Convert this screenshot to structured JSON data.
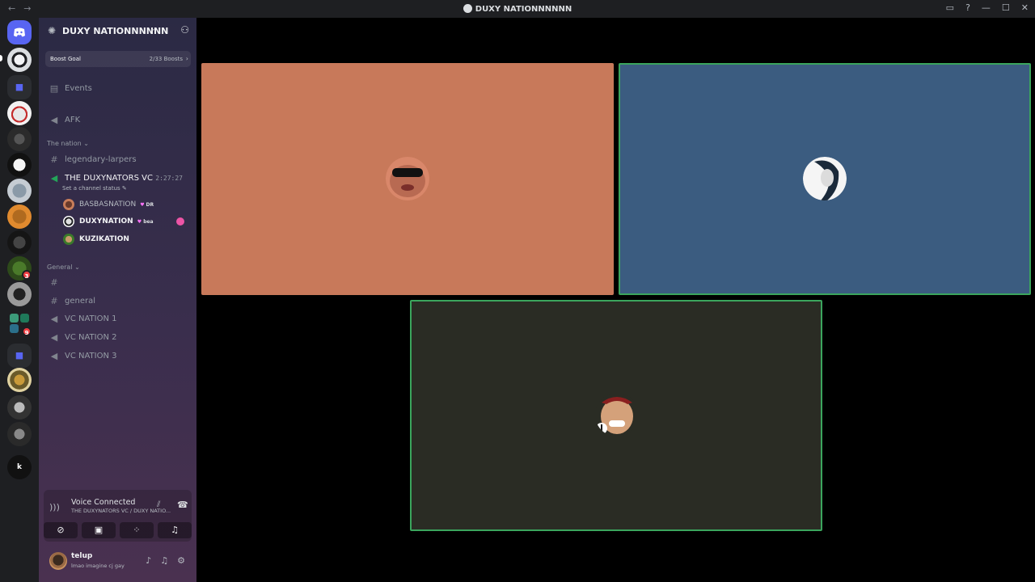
{
  "window": {
    "title": "DUXY NATIONNNNNN",
    "nav_back": "←",
    "nav_forward": "→"
  },
  "colors": {
    "tile1": "#c8795a",
    "tile2": "#3b5c80",
    "tile3": "#2a2c24",
    "speaking_border": "#3ba55d"
  },
  "server": {
    "name": "DUXY NATIONNNNNN",
    "boost_label": "Boost Goal",
    "boost_count": "2/33 Boosts"
  },
  "channels": {
    "events": "Events",
    "afk": "AFK",
    "category_nation": "The nation",
    "legendary": "legendary-larpers",
    "vc_name": "THE DUXYNATORS VC",
    "vc_timer": "2:27:27",
    "vc_status": "Set a channel status",
    "members": [
      {
        "name": "BASBASNATION",
        "tag": "DR"
      },
      {
        "name": "DUXYNATION",
        "tag": "bea"
      },
      {
        "name": "KUZIKATION",
        "tag": ""
      }
    ],
    "category_general": "General",
    "ch_blank": "",
    "ch_general": "general",
    "vc1": "VC NATION 1",
    "vc2": "VC NATION 2",
    "vc3": "VC NATION 3"
  },
  "voice": {
    "status": "Voice Connected",
    "sub": "THE DUXYNATORS VC / DUXY NATIO..."
  },
  "user": {
    "name": "telup",
    "status": "lmao imagine cj gay"
  },
  "rail": {
    "dm_badge_1": "3",
    "dm_badge_2": "9",
    "letter_server": "k"
  }
}
